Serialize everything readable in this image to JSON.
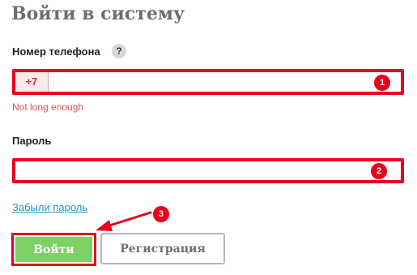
{
  "form": {
    "title": "Войти в систему",
    "phone_label": "Номер телефона",
    "help_icon": "?",
    "phone_prefix": "+7",
    "phone_value": "",
    "phone_error": "Not long enough",
    "password_label": "Пароль",
    "password_value": "",
    "forgot_link": "Забыли пароль",
    "login_button": "Войти",
    "register_button": "Регистрация"
  },
  "annotations": {
    "badge_1": "1",
    "badge_2": "2",
    "badge_3": "3"
  },
  "colors": {
    "highlight": "#e8001c",
    "login_button_bg": "#7fd067",
    "error_text": "#e0504f",
    "link": "#2a8fc9"
  }
}
